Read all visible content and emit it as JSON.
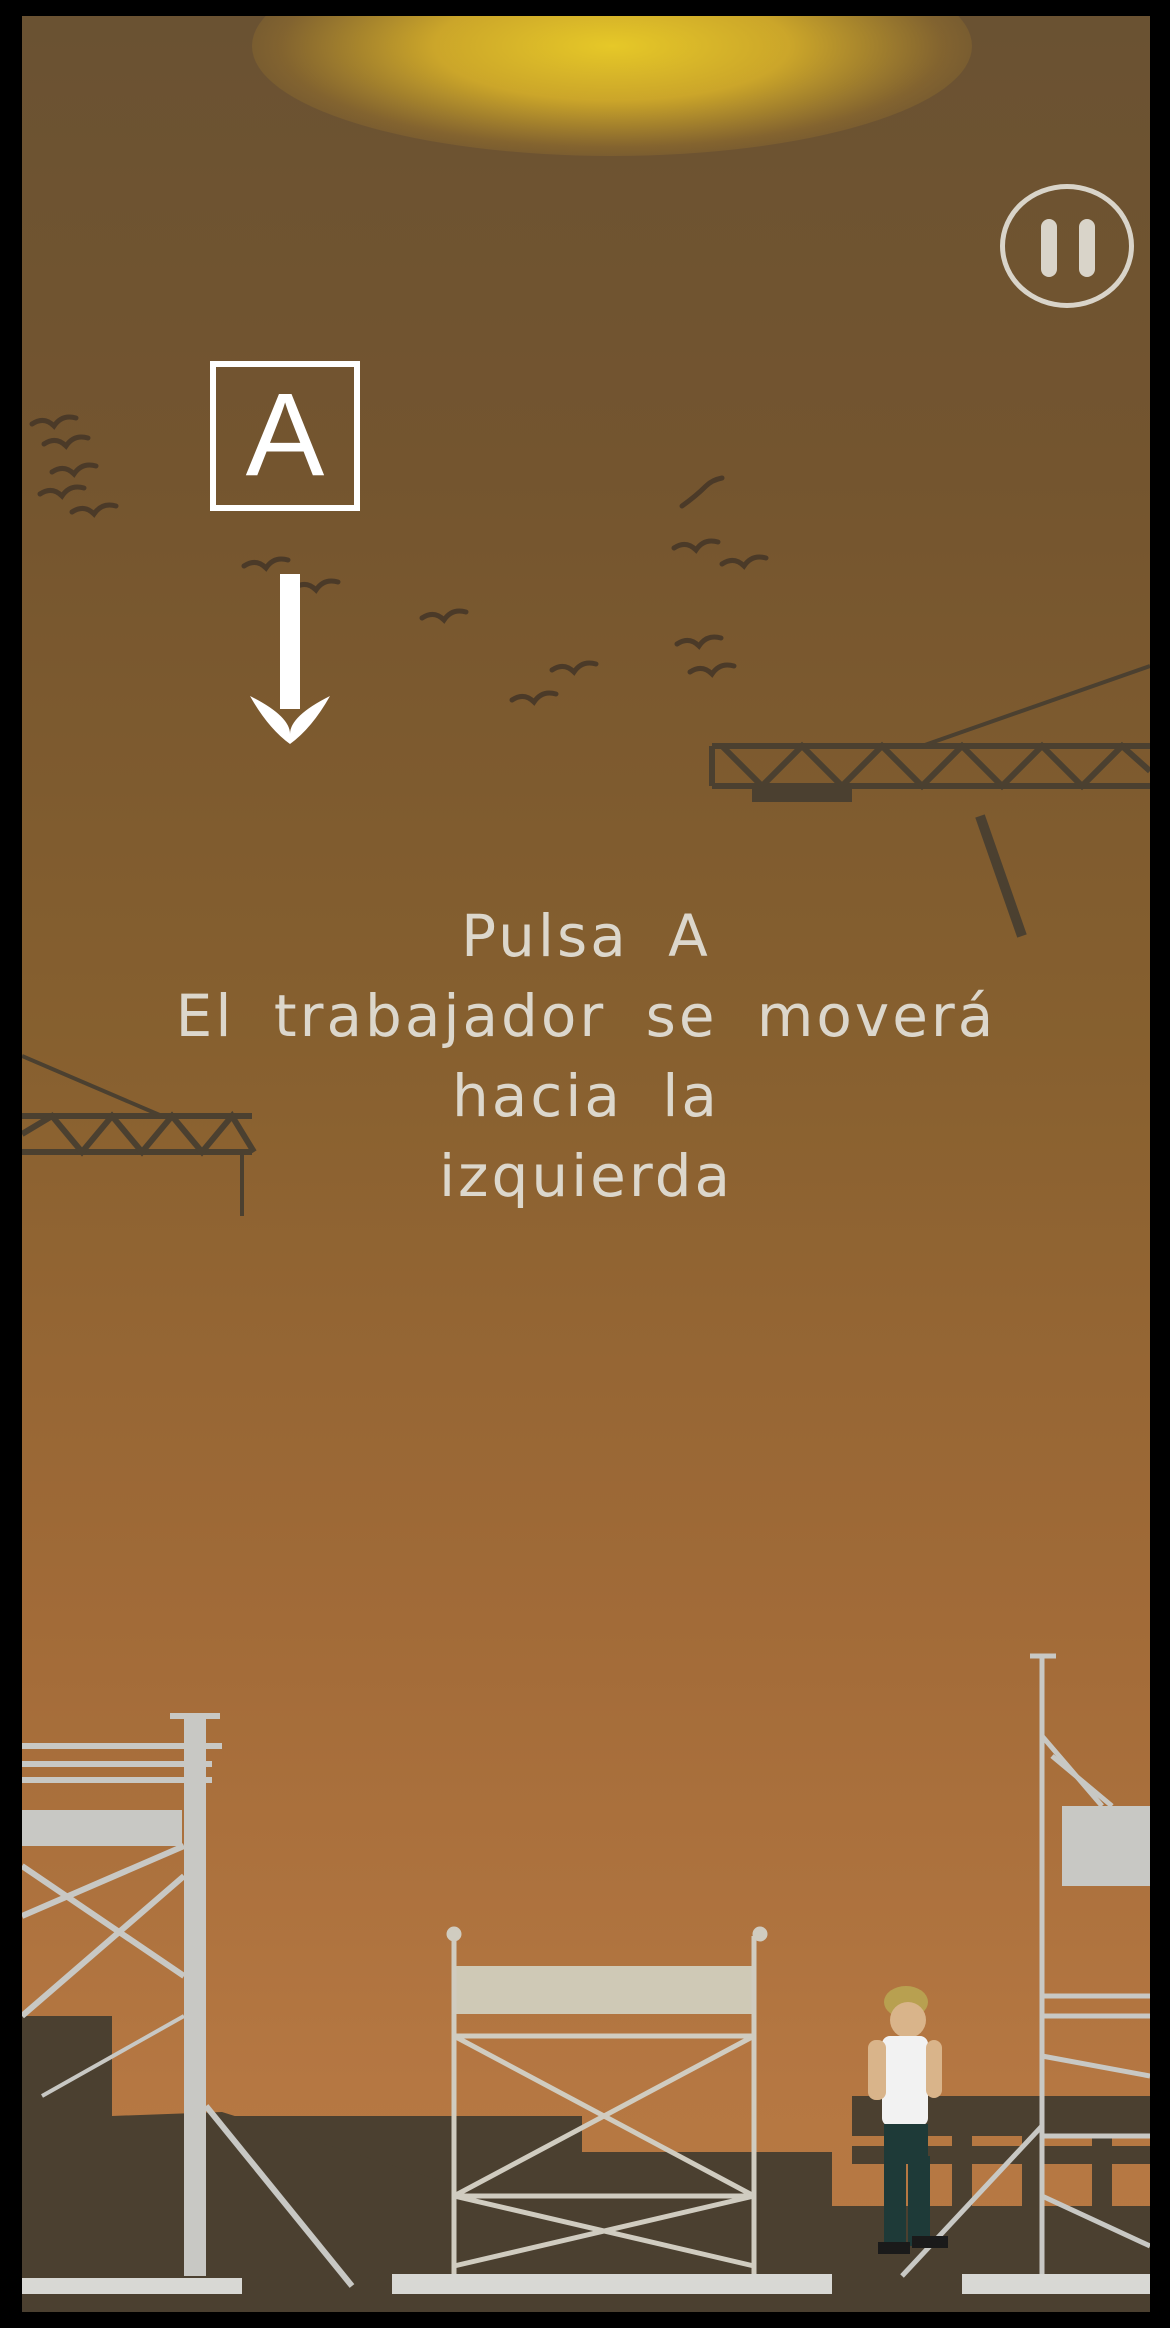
{
  "tutorial": {
    "key_label": "A",
    "line1": "Pulsa A",
    "line2": "El trabajador se moverá hacia la",
    "line3": "izquierda"
  },
  "icons": {
    "pause": "pause-icon",
    "arrow": "arrow-down-icon"
  },
  "colors": {
    "sky_top": "#6a5232",
    "sky_bottom": "#b87a44",
    "sun": "#e6c828",
    "silhouette": "#4b4030",
    "scaffold": "#c8c8c4",
    "text": "#dcd7cc"
  }
}
